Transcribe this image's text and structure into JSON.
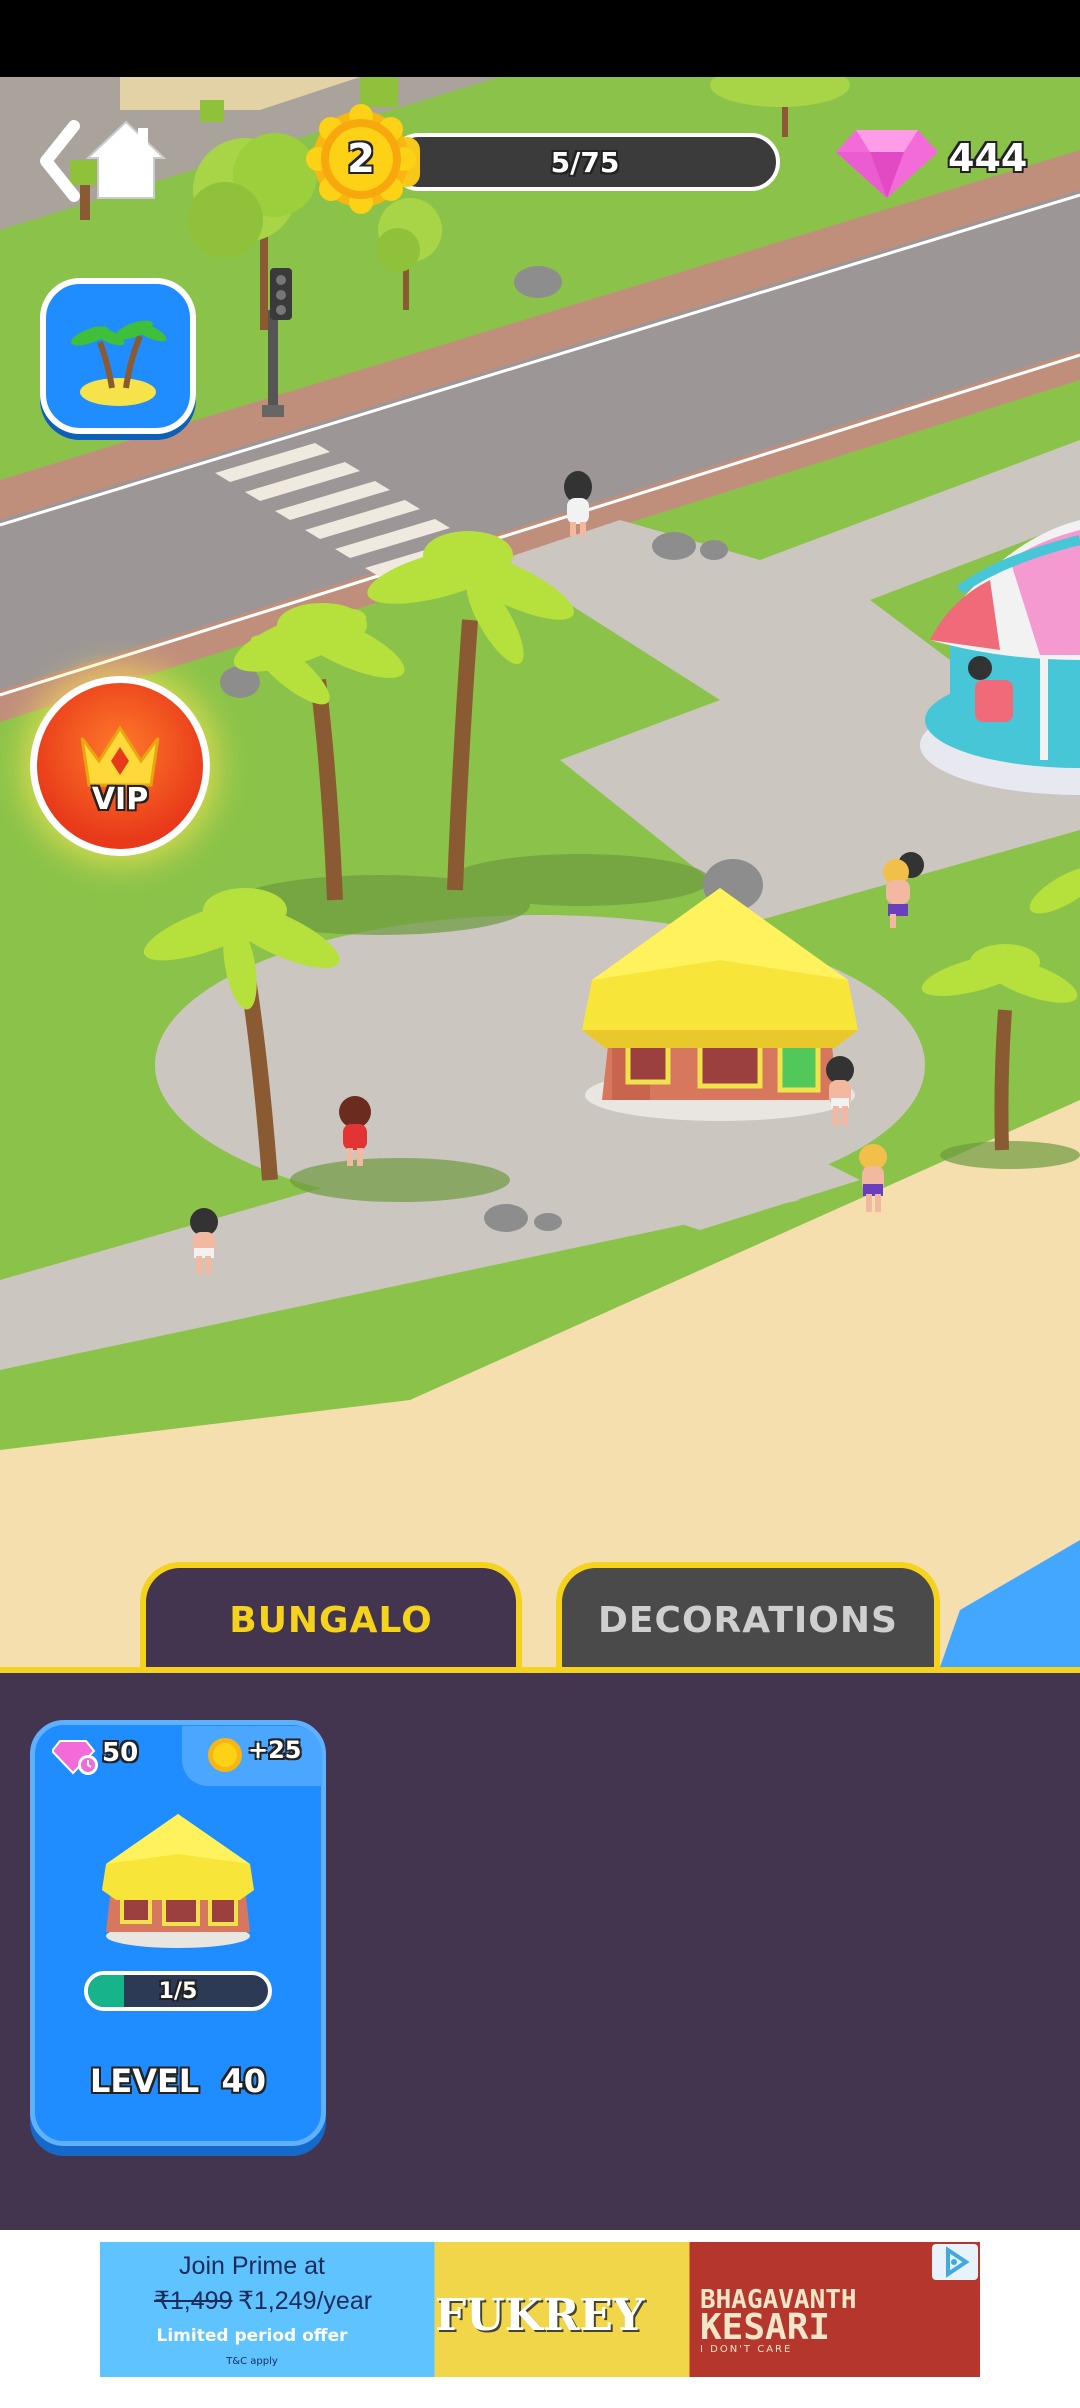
{
  "hud": {
    "level": "2",
    "progress_label": "5/75",
    "progress_fraction": 0.067,
    "gem_count": "444"
  },
  "vip": {
    "label": "VIP"
  },
  "tabs": [
    {
      "label": "BUNGALO",
      "active": true
    },
    {
      "label": "DECORATIONS",
      "active": false
    }
  ],
  "card": {
    "gem_cost": "50",
    "coin_reward": "+25",
    "progress_label": "1/5",
    "progress_fraction": 0.2,
    "level_label": "LEVEL",
    "level_value": "40"
  },
  "ad": {
    "line1": "Join Prime at",
    "price_old": "₹1,499",
    "price_new": "₹1,249/year",
    "offer": "Limited period offer",
    "terms": "T&C apply",
    "movie1": "FUKREY",
    "movie2_line1": "BHAGAVANTH",
    "movie2_line2": "KESARI",
    "movie2_tagline": "I DON'T CARE"
  },
  "colors": {
    "grass": "#8bc34a",
    "road": "#9c9696",
    "path": "#cbc6c0",
    "sand": "#f6dfaf",
    "panel": "#433550",
    "accent_yellow": "#f5d31c",
    "card_blue": "#1f8cff"
  },
  "icons": {
    "back": "chevron-left-icon",
    "home": "home-icon",
    "level": "sun-badge-icon",
    "gems": "diamond-icon",
    "island": "palm-island-icon",
    "vip": "crown-icon",
    "ad_choices": "ad-choices-icon"
  }
}
